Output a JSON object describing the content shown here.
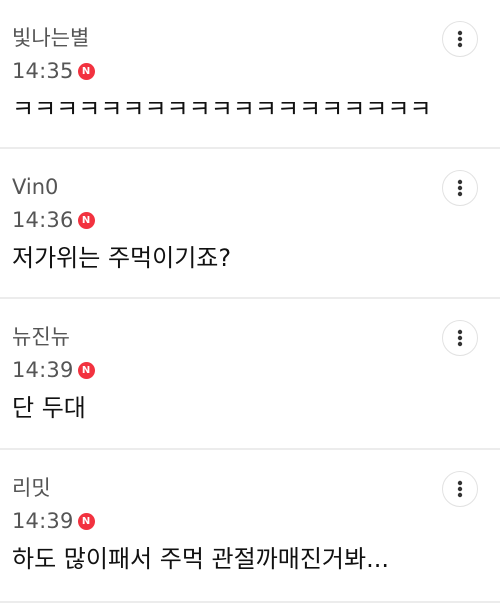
{
  "comments": [
    {
      "nickname": "빛나는별",
      "time": "14:35",
      "badge": "N",
      "text": "ㅋㅋㅋㅋㅋㅋㅋㅋㅋㅋㅋㅋㅋㅋㅋㅋㅋㅋㅋ"
    },
    {
      "nickname": "Vin0",
      "time": "14:36",
      "badge": "N",
      "text": "저가위는 주먹이기죠?"
    },
    {
      "nickname": "뉴진뉴",
      "time": "14:39",
      "badge": "N",
      "text": "단 두대"
    },
    {
      "nickname": "리밋",
      "time": "14:39",
      "badge": "N",
      "text": "하도 많이패서 주먹 관절까매진거봐..."
    }
  ],
  "icons": {
    "more": "more-vertical-icon",
    "badge": "new-badge"
  },
  "colors": {
    "badge": "#f2323f",
    "meta_text": "#555555",
    "body_text": "#111111",
    "divider": "#ececec"
  }
}
